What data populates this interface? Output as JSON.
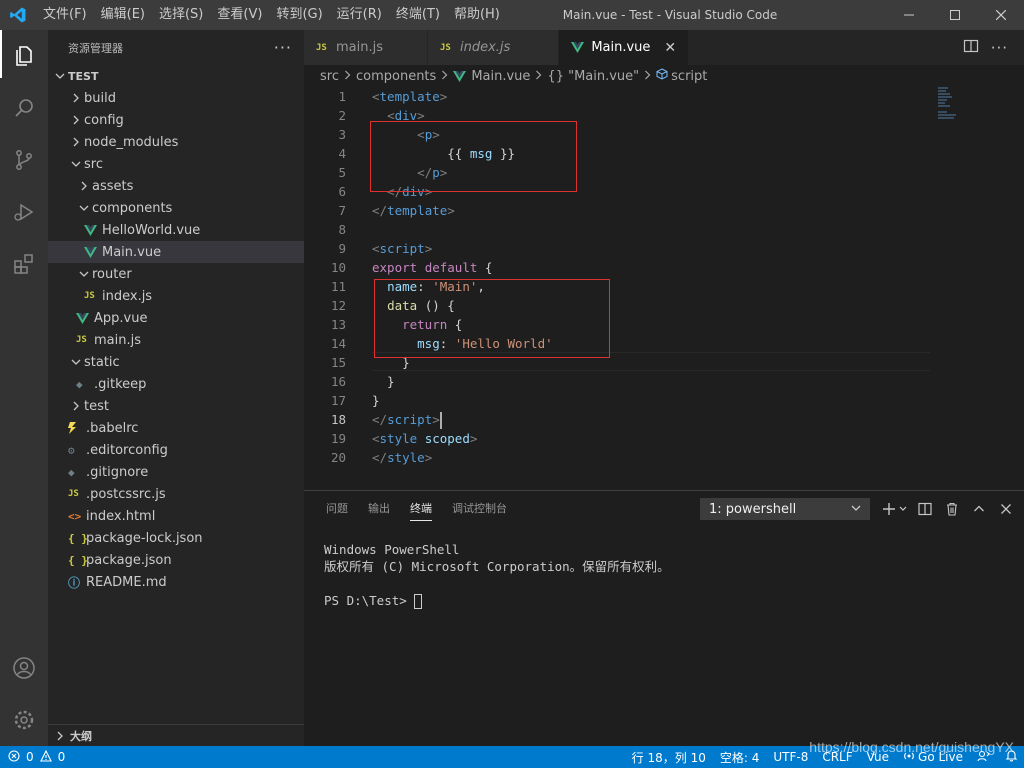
{
  "titlebar": {
    "menu": [
      "文件(F)",
      "编辑(E)",
      "选择(S)",
      "查看(V)",
      "转到(G)",
      "运行(R)",
      "终端(T)",
      "帮助(H)"
    ],
    "title": "Main.vue - Test - Visual Studio Code"
  },
  "sidebar": {
    "header": "资源管理器",
    "more": "···",
    "tree": [
      {
        "label": "TEST",
        "depth": 0,
        "kind": "root",
        "open": true
      },
      {
        "label": "build",
        "depth": 1,
        "kind": "folder",
        "open": false
      },
      {
        "label": "config",
        "depth": 1,
        "kind": "folder",
        "open": false
      },
      {
        "label": "node_modules",
        "depth": 1,
        "kind": "folder",
        "open": false
      },
      {
        "label": "src",
        "depth": 1,
        "kind": "folder",
        "open": true
      },
      {
        "label": "assets",
        "depth": 2,
        "kind": "folder",
        "open": false
      },
      {
        "label": "components",
        "depth": 2,
        "kind": "folder",
        "open": true
      },
      {
        "label": "HelloWorld.vue",
        "depth": 3,
        "kind": "vue"
      },
      {
        "label": "Main.vue",
        "depth": 3,
        "kind": "vue",
        "selected": true
      },
      {
        "label": "router",
        "depth": 2,
        "kind": "folder",
        "open": true
      },
      {
        "label": "index.js",
        "depth": 3,
        "kind": "js"
      },
      {
        "label": "App.vue",
        "depth": 2,
        "kind": "vue"
      },
      {
        "label": "main.js",
        "depth": 2,
        "kind": "js"
      },
      {
        "label": "static",
        "depth": 1,
        "kind": "folder",
        "open": true
      },
      {
        "label": ".gitkeep",
        "depth": 2,
        "kind": "gray"
      },
      {
        "label": "test",
        "depth": 1,
        "kind": "folder",
        "open": false
      },
      {
        "label": ".babelrc",
        "depth": 1,
        "kind": "babel"
      },
      {
        "label": ".editorconfig",
        "depth": 1,
        "kind": "gear"
      },
      {
        "label": ".gitignore",
        "depth": 1,
        "kind": "gray"
      },
      {
        "label": ".postcssrc.js",
        "depth": 1,
        "kind": "js"
      },
      {
        "label": "index.html",
        "depth": 1,
        "kind": "html"
      },
      {
        "label": "package-lock.json",
        "depth": 1,
        "kind": "json"
      },
      {
        "label": "package.json",
        "depth": 1,
        "kind": "json"
      },
      {
        "label": "README.md",
        "depth": 1,
        "kind": "md"
      }
    ],
    "outline": "大纲"
  },
  "tabs": [
    {
      "label": "main.js",
      "icon": "JS",
      "italic": false,
      "active": false
    },
    {
      "label": "index.js",
      "icon": "JS",
      "italic": true,
      "active": false
    },
    {
      "label": "Main.vue",
      "icon": "vue",
      "italic": false,
      "active": true,
      "close": "✕"
    }
  ],
  "breadcrumb": [
    "src",
    "components",
    "Main.vue",
    "{} \"Main.vue\"",
    "script"
  ],
  "code": {
    "current_line": 18,
    "lines": [
      [
        [
          "t-tag",
          "<"
        ],
        [
          "t-name",
          "template"
        ],
        [
          "t-tag",
          ">"
        ]
      ],
      [
        [
          "t-txt",
          "  "
        ],
        [
          "t-tag",
          "<"
        ],
        [
          "t-name",
          "div"
        ],
        [
          "t-tag",
          ">"
        ]
      ],
      [
        [
          "t-txt",
          "      "
        ],
        [
          "t-tag",
          "<"
        ],
        [
          "t-name",
          "p"
        ],
        [
          "t-tag",
          ">"
        ]
      ],
      [
        [
          "t-txt",
          "          {{ "
        ],
        [
          "t-prop",
          "msg"
        ],
        [
          "t-txt",
          " }}"
        ]
      ],
      [
        [
          "t-txt",
          "      "
        ],
        [
          "t-tag",
          "</"
        ],
        [
          "t-name",
          "p"
        ],
        [
          "t-tag",
          ">"
        ]
      ],
      [
        [
          "t-txt",
          "  "
        ],
        [
          "t-tag",
          "</"
        ],
        [
          "t-name",
          "div"
        ],
        [
          "t-tag",
          ">"
        ]
      ],
      [
        [
          "t-tag",
          "</"
        ],
        [
          "t-name",
          "template"
        ],
        [
          "t-tag",
          ">"
        ]
      ],
      [],
      [
        [
          "t-tag",
          "<"
        ],
        [
          "t-name",
          "script"
        ],
        [
          "t-tag",
          ">"
        ]
      ],
      [
        [
          "t-kw",
          "export"
        ],
        [
          "t-txt",
          " "
        ],
        [
          "t-kw",
          "default"
        ],
        [
          "t-txt",
          " {"
        ]
      ],
      [
        [
          "t-txt",
          "  "
        ],
        [
          "t-prop",
          "name"
        ],
        [
          "t-txt",
          ": "
        ],
        [
          "t-str",
          "'Main'"
        ],
        [
          "t-txt",
          ","
        ]
      ],
      [
        [
          "t-txt",
          "  "
        ],
        [
          "t-fn",
          "data"
        ],
        [
          "t-txt",
          " () {"
        ]
      ],
      [
        [
          "t-txt",
          "    "
        ],
        [
          "t-kw",
          "return"
        ],
        [
          "t-txt",
          " {"
        ]
      ],
      [
        [
          "t-txt",
          "      "
        ],
        [
          "t-prop",
          "msg"
        ],
        [
          "t-txt",
          ": "
        ],
        [
          "t-str",
          "'Hello World'"
        ]
      ],
      [
        [
          "t-txt",
          "    }"
        ]
      ],
      [
        [
          "t-txt",
          "  }"
        ]
      ],
      [
        [
          "t-txt",
          "}"
        ]
      ],
      [
        [
          "t-tag",
          "</"
        ],
        [
          "t-name",
          "script"
        ],
        [
          "t-tag",
          ">"
        ]
      ],
      [
        [
          "t-tag",
          "<"
        ],
        [
          "t-name",
          "style"
        ],
        [
          "t-txt",
          " "
        ],
        [
          "t-attr",
          "scoped"
        ],
        [
          "t-tag",
          ">"
        ]
      ],
      [
        [
          "t-tag",
          "</"
        ],
        [
          "t-name",
          "style"
        ],
        [
          "t-tag",
          ">"
        ]
      ]
    ]
  },
  "panel": {
    "tabs": [
      "问题",
      "输出",
      "终端",
      "调试控制台"
    ],
    "active_tab": "终端",
    "terminal_select": "1: powershell",
    "terminal_lines": [
      "Windows PowerShell",
      "版权所有 (C) Microsoft Corporation。保留所有权利。",
      "",
      "PS D:\\Test> "
    ]
  },
  "statusbar": {
    "errors": "0",
    "warnings": "0",
    "position": "行 18，列 10",
    "spaces": "空格: 4",
    "encoding": "UTF-8",
    "eol": "CRLF",
    "language": "Vue",
    "golive": "Go Live"
  },
  "watermark": "https://blog.csdn.net/guishengYX",
  "colors": {
    "accent": "#007acc",
    "vue": "#41b883",
    "highlight_box": "#e03131"
  }
}
